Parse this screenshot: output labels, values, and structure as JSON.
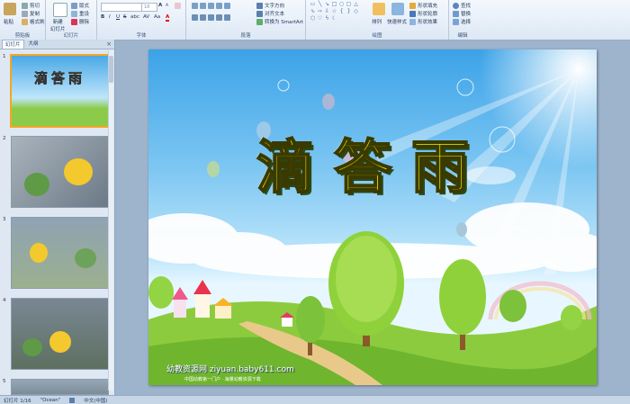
{
  "ribbon": {
    "clipboard": {
      "label": "剪贴板",
      "paste": "粘贴",
      "cut": "剪切",
      "copy": "复制",
      "format": "格式刷"
    },
    "slides": {
      "label": "幻灯片",
      "new": "新建",
      "new2": "幻灯片",
      "layout": "版式",
      "reset": "重设",
      "delete": "删除"
    },
    "font": {
      "label": "字体",
      "name": "",
      "size": "18",
      "bold": "B",
      "italic": "I",
      "underline": "U",
      "strike": "S",
      "shadow": "abc",
      "spacing": "AV",
      "case": "Aa",
      "color": "A",
      "grow": "A",
      "shrink": "A"
    },
    "paragraph": {
      "label": "段落",
      "direction": "文字方向",
      "align": "对齐文本",
      "smartart": "转换为 SmartArt"
    },
    "drawing": {
      "label": "绘图",
      "arrange": "排列",
      "styles": "快速样式",
      "fill": "形状填充",
      "outline": "形状轮廓",
      "effects": "形状效果"
    },
    "editing": {
      "label": "编辑",
      "find": "查找",
      "replace": "替换",
      "select": "选择"
    }
  },
  "panel": {
    "tab_slides": "幻灯片",
    "tab_outline": "大纲",
    "close": "×",
    "numbers": [
      "1",
      "2",
      "3",
      "4",
      "5"
    ]
  },
  "slide": {
    "title": "滴答雨",
    "footer": "幼教资源网 ziyuan.baby611.com",
    "footer_sub": "中国幼教第一门户 · 海量幼教资源下载"
  },
  "status": {
    "slide_info": "幻灯片 1/16",
    "theme": "\"Ocean\"",
    "lang": "中文(中国)"
  },
  "colors": {
    "ribbon": "#dde8f5",
    "sky": "#3ca3e8",
    "title": "#f4f00a",
    "grass": "#7cc23a",
    "selection": "#f5a623"
  }
}
